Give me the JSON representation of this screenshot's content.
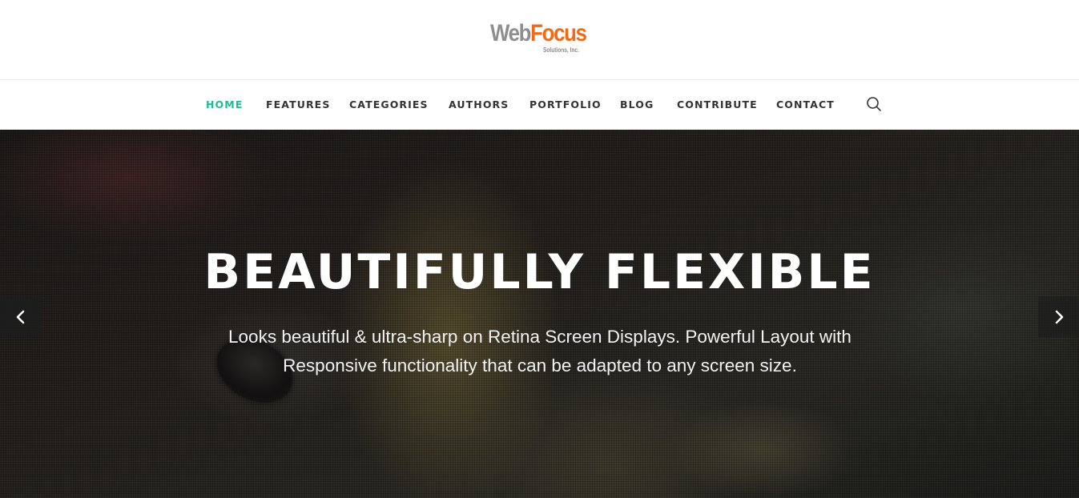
{
  "brand": {
    "name_part1": "Web",
    "name_part2": "Focus",
    "tagline": "Solutions, Inc.",
    "colors": {
      "gray": "#8e8e8e",
      "orange": "#ef6b18"
    }
  },
  "nav": {
    "items": [
      {
        "label": "HOME",
        "active": true
      },
      {
        "label": "FEATURES",
        "active": false
      },
      {
        "label": "CATEGORIES",
        "active": false
      },
      {
        "label": "AUTHORS",
        "active": false
      },
      {
        "label": "PORTFOLIO",
        "active": false
      },
      {
        "label": "BLOG",
        "active": false
      },
      {
        "label": "CONTRIBUTE",
        "active": false
      },
      {
        "label": "CONTACT",
        "active": false
      }
    ],
    "search_icon": "search-icon",
    "active_color": "#1abc9c"
  },
  "hero": {
    "title": "BEAUTIFULLY FLEXIBLE",
    "text": "Looks beautiful & ultra-sharp on Retina Screen Displays. Powerful Layout with Responsive functionality that can be adapted to any screen size.",
    "prev_icon": "chevron-left-icon",
    "next_icon": "chevron-right-icon"
  }
}
